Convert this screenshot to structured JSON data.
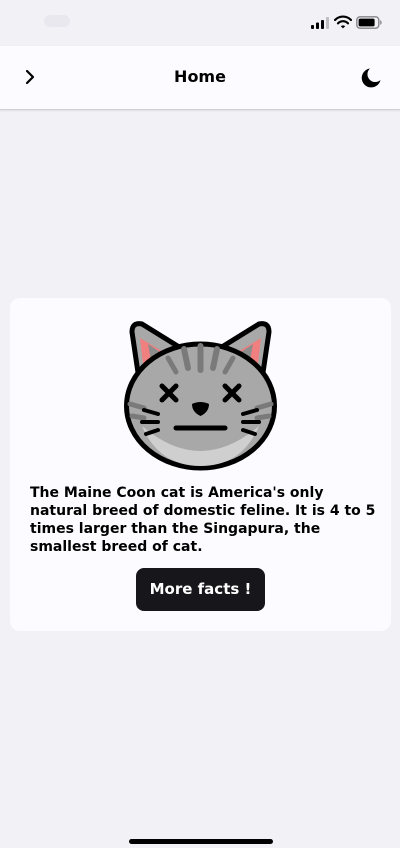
{
  "nav": {
    "title": "Home",
    "back_icon": "chevron-right-icon",
    "theme_icon": "moon-icon"
  },
  "card": {
    "image": "cat-face-icon",
    "fact": "The Maine Coon cat is America's only natural breed of domestic feline. It is 4 to 5 times larger than the Singapura, the smallest breed of cat.",
    "button_label": "More facts !"
  },
  "colors": {
    "background": "#f2f1f6",
    "surface": "#fcfbff",
    "button": "#17161b",
    "button_text": "#ffffff",
    "cat_fur": "#a8a8a8",
    "cat_ear_inner": "#f07f7f"
  }
}
